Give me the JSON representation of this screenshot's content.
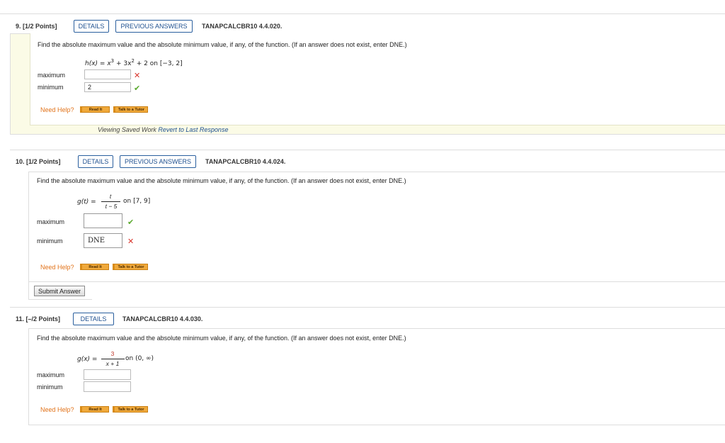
{
  "q9": {
    "number": "9.",
    "points": "[1/2 Points]",
    "details_label": "DETAILS",
    "previous_label": "PREVIOUS ANSWERS",
    "code": "TANAPCALCBR10 4.4.020.",
    "prompt": "Find the absolute maximum value and the absolute minimum value, if any, of the function. (If an answer does not exist, enter DNE.)",
    "fn_name": "h(x) = x",
    "fn_exp1": "3",
    "fn_mid": " + 3x",
    "fn_exp2": "2",
    "fn_tail": " + 2 on [−3, 2]",
    "max_label": "maximum",
    "max_value": "",
    "min_label": "minimum",
    "min_value": "2",
    "need_help": "Need Help?",
    "read_it": "Read It",
    "talk_tutor": "Talk to a Tutor",
    "viewing": "Viewing Saved Work",
    "revert": "Revert to Last Response"
  },
  "q10": {
    "number": "10.",
    "points": "[1/2 Points]",
    "details_label": "DETAILS",
    "previous_label": "PREVIOUS ANSWERS",
    "code": "TANAPCALCBR10 4.4.024.",
    "prompt": "Find the absolute maximum value and the absolute minimum value, if any, of the function. (If an answer does not exist, enter DNE.)",
    "fn_lhs": "g(t) =",
    "fn_num": "t",
    "fn_den": "t − 5",
    "fn_tail": "on [7, 9]",
    "max_label": "maximum",
    "max_value": "",
    "min_label": "minimum",
    "min_value": "DNE",
    "need_help": "Need Help?",
    "read_it": "Read It",
    "talk_tutor": "Talk to a Tutor",
    "submit": "Submit Answer"
  },
  "q11": {
    "number": "11.",
    "points": "[–/2 Points]",
    "details_label": "DETAILS",
    "code": "TANAPCALCBR10 4.4.030.",
    "prompt": "Find the absolute maximum value and the absolute minimum value, if any, of the function. (If an answer does not exist, enter DNE.)",
    "fn_lhs": "g(x) =",
    "fn_num": "3",
    "fn_den": "x + 1",
    "fn_tail": "on (0, ∞)",
    "max_label": "maximum",
    "max_value": "",
    "min_label": "minimum",
    "min_value": "",
    "need_help": "Need Help?",
    "read_it": "Read It",
    "talk_tutor": "Talk to a Tutor"
  },
  "colors": {
    "accent": "#1d4f8f",
    "correct": "#5aa92d",
    "incorrect": "#d9342b",
    "help": "#e2731a",
    "saved_bg": "#fbfbe6"
  }
}
